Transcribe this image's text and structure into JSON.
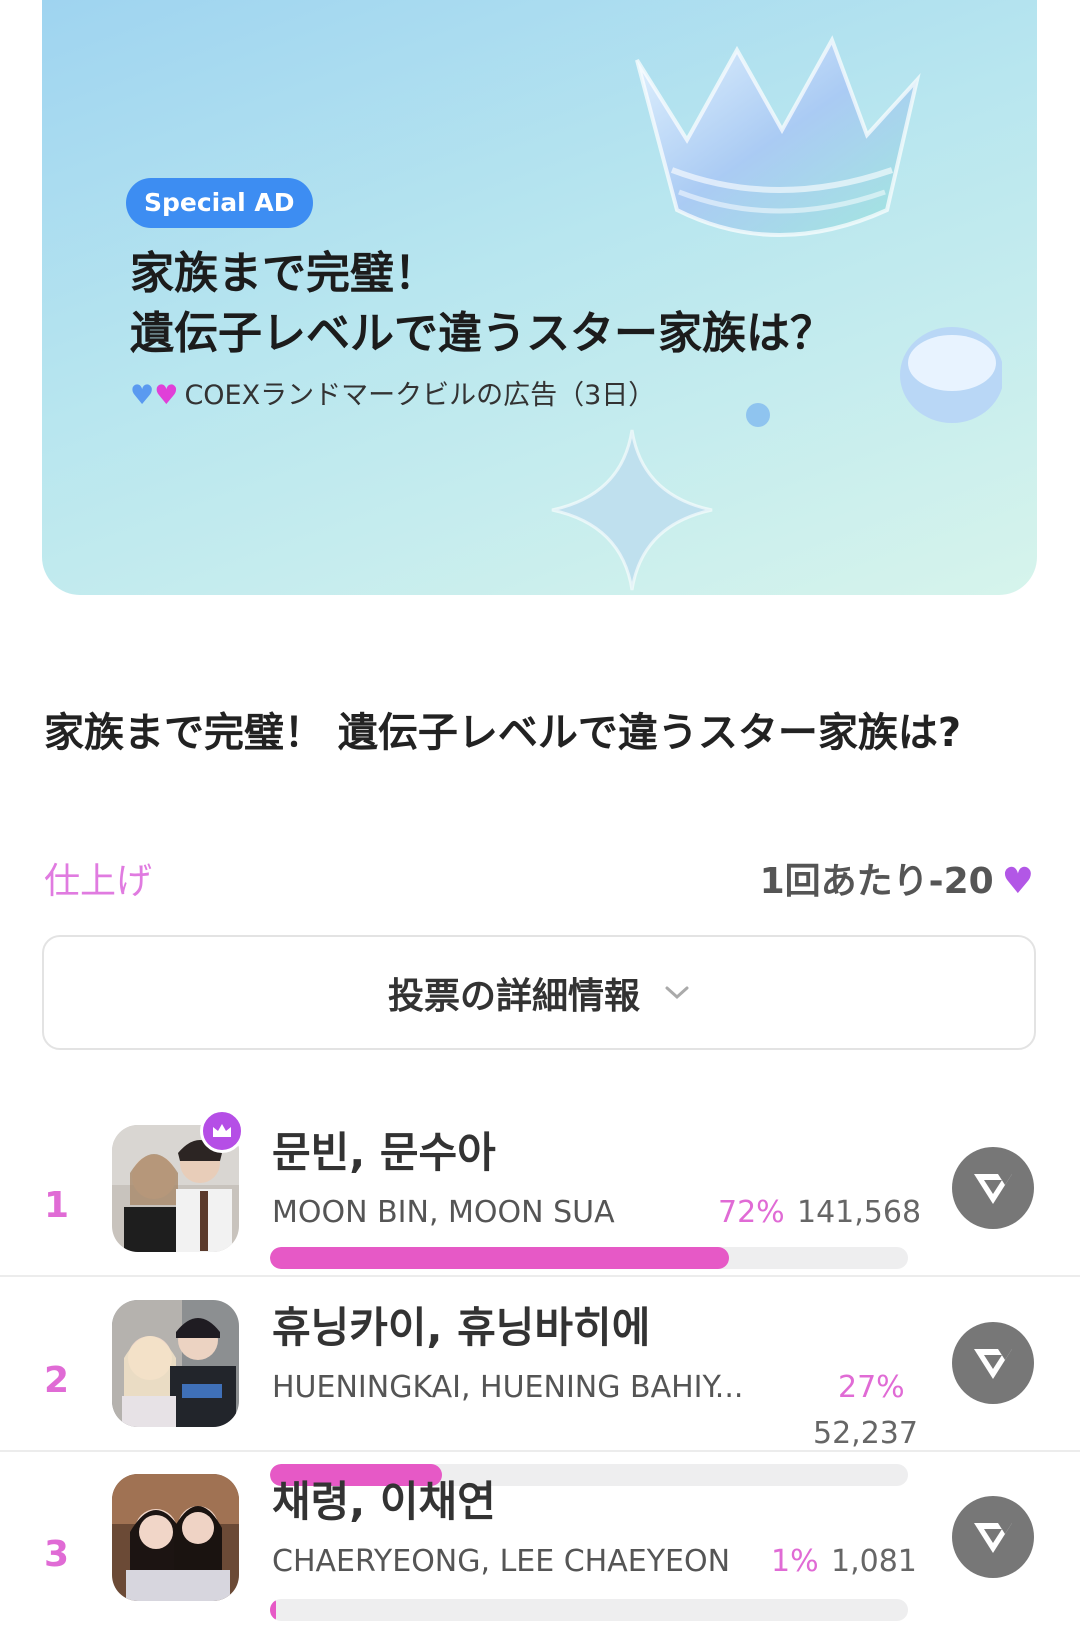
{
  "banner": {
    "badge": "Special AD",
    "headline_line1": "家族まで完璧！",
    "headline_line2": "遺伝子レベルで違うスター家族は？",
    "subline": "COEXランドマークビルの広告（3日）",
    "accent": "#3d8df2"
  },
  "poll": {
    "title": "家族まで完璧！ 遺伝子レベルで違うスター家族は?",
    "status": "仕上げ",
    "cost": "1回あたり-20",
    "details_button": "投票の詳細情報"
  },
  "candidates": [
    {
      "rank": "1",
      "name_ko": "문빈, 문수아",
      "name_en": "MOON BIN, MOON SUA",
      "percent_label": "72%",
      "percent": 72,
      "votes": "141,568"
    },
    {
      "rank": "2",
      "name_ko": "휴닝카이, 휴닝바히에",
      "name_en": "HUENINGKAI, HUENING BAHIY...",
      "percent_label": "27%",
      "percent": 27,
      "votes": "52,237"
    },
    {
      "rank": "3",
      "name_ko": "채령, 이채연",
      "name_en": "CHAERYEONG, LEE CHAEYEON",
      "percent_label": "1%",
      "percent": 1,
      "votes": "1,081"
    }
  ],
  "colors": {
    "pink": "#e659c6",
    "purple": "#b54ee6",
    "bar_bg": "#eeeeef"
  },
  "icons": [
    "heart-icon",
    "chevron-down-icon",
    "crown-icon",
    "vote-logo-icon"
  ]
}
